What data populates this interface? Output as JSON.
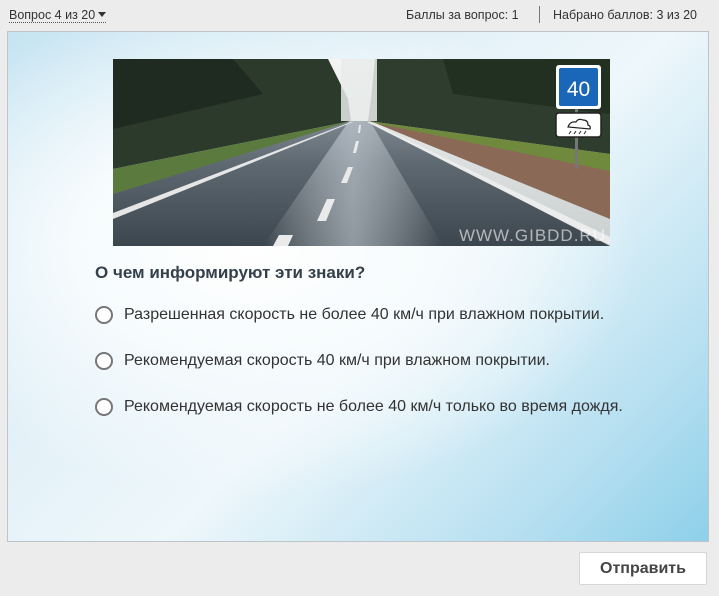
{
  "header": {
    "question_nav": "Вопрос 4 из 20",
    "points_per_question": "Баллы за вопрос: 1",
    "points_total": "Набрано баллов: 3 из 20"
  },
  "image": {
    "watermark": "WWW.GIBDD.RU",
    "sign_speed": "40",
    "sign_plate_icon": "wet-road-icon"
  },
  "question": "О чем информируют эти знаки?",
  "options": [
    {
      "label": "Разрешенная скорость не более 40 км/ч при влажном покрытии.",
      "selected": false
    },
    {
      "label": "Рекомендуемая скорость 40 км/ч при влажном покрытии.",
      "selected": false
    },
    {
      "label": "Рекомендуемая скорость не более 40 км/ч только во время дождя.",
      "selected": false
    }
  ],
  "submit_label": "Отправить"
}
